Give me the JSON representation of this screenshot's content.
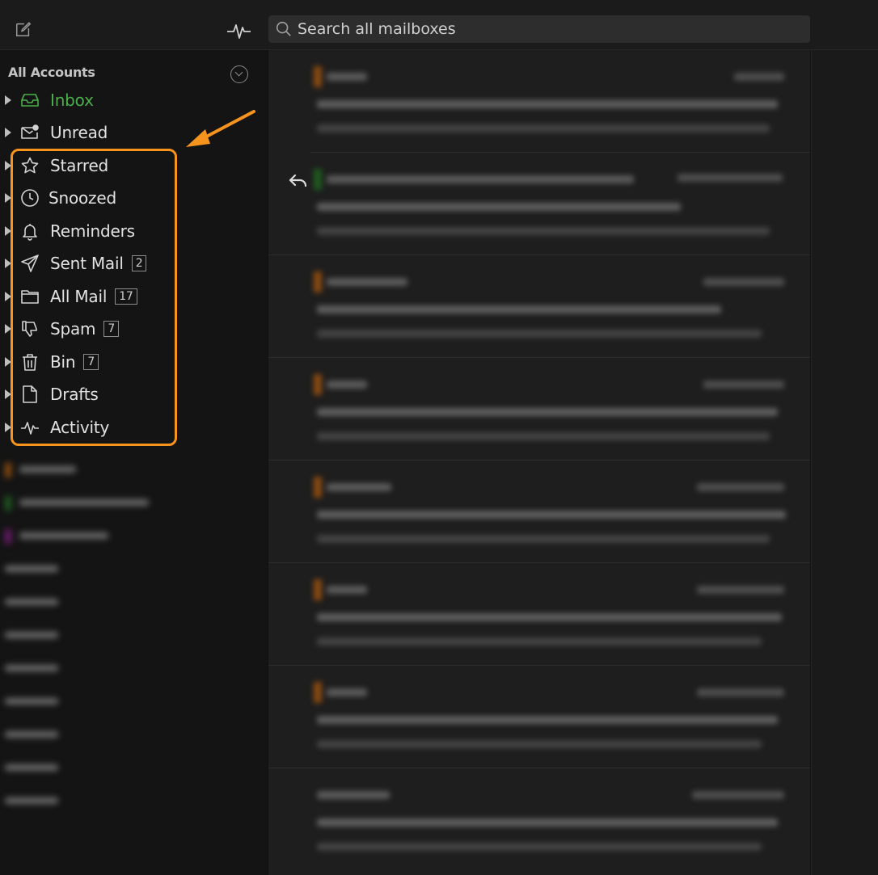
{
  "toolbar": {
    "compose_icon": "compose-icon",
    "activity_icon": "pulse-icon"
  },
  "search": {
    "placeholder": "Search all mailboxes"
  },
  "sidebar": {
    "header": "All Accounts",
    "folders": [
      {
        "id": "inbox",
        "label": "Inbox",
        "icon": "inbox-icon",
        "count": ""
      },
      {
        "id": "unread",
        "label": "Unread",
        "icon": "unread-mail-icon",
        "count": ""
      },
      {
        "id": "starred",
        "label": "Starred",
        "icon": "star-icon",
        "count": ""
      },
      {
        "id": "snoozed",
        "label": "Snoozed",
        "icon": "clock-icon",
        "count": ""
      },
      {
        "id": "reminders",
        "label": "Reminders",
        "icon": "bell-icon",
        "count": ""
      },
      {
        "id": "sent",
        "label": "Sent Mail",
        "icon": "paper-plane-icon",
        "count": "2"
      },
      {
        "id": "allmail",
        "label": "All Mail",
        "icon": "folder-icon",
        "count": "17"
      },
      {
        "id": "spam",
        "label": "Spam",
        "icon": "thumbs-down-icon",
        "count": "7"
      },
      {
        "id": "bin",
        "label": "Bin",
        "icon": "trash-icon",
        "count": "7"
      },
      {
        "id": "drafts",
        "label": "Drafts",
        "icon": "document-icon",
        "count": ""
      },
      {
        "id": "activity",
        "label": "Activity",
        "icon": "activity-icon",
        "count": ""
      }
    ]
  },
  "colors": {
    "accent_inbox": "#4cae4c",
    "highlight": "#f7941d",
    "background": "#121212",
    "list_background": "#1e1e1e"
  }
}
